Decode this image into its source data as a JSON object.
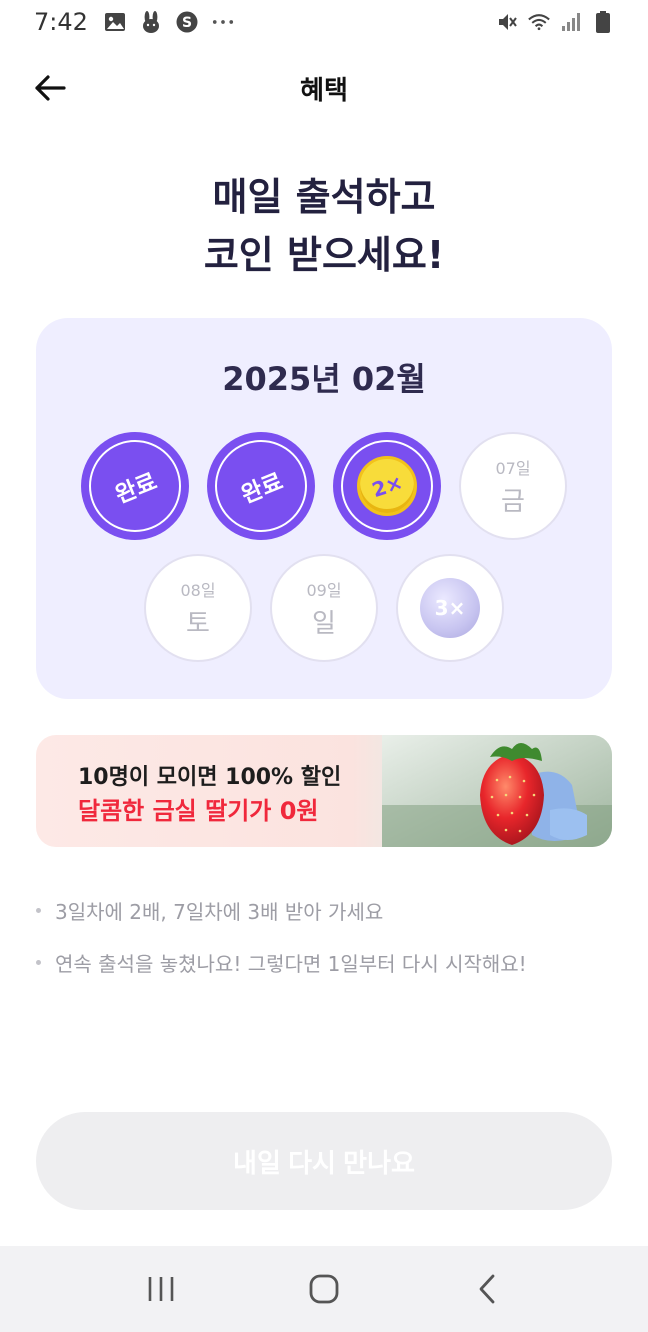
{
  "status_bar": {
    "time": "7:42",
    "icons_left": [
      "image-icon",
      "bunny-icon",
      "s-app-icon",
      "more-dots-icon"
    ],
    "icons_right": [
      "mute-icon",
      "wifi-icon",
      "signal-icon",
      "battery-icon"
    ]
  },
  "header": {
    "title": "혜택",
    "back_icon": "arrow-left-icon"
  },
  "hero": {
    "line1": "매일 출석하고",
    "line2": "코인 받으세요!"
  },
  "calendar": {
    "month": "2025년 02월",
    "days": [
      {
        "state": "done",
        "label": "완료"
      },
      {
        "state": "done",
        "label": "완료"
      },
      {
        "state": "today-bonus",
        "badge": "2×"
      },
      {
        "state": "future",
        "date": "07일",
        "weekday": "금"
      },
      {
        "state": "future",
        "date": "08일",
        "weekday": "토"
      },
      {
        "state": "future",
        "date": "09일",
        "weekday": "일"
      },
      {
        "state": "bonus",
        "badge": "3×"
      }
    ]
  },
  "banner": {
    "line1": "10명이 모이면 100% 할인",
    "line2": "달콤한 금실 딸기가 0원",
    "accent_color": "#f0283c"
  },
  "notes": [
    "3일차에 2배, 7일차에 3배 받아 가세요",
    "연속 출석을 놓쳤나요! 그렇다면 1일부터 다시 시작해요!"
  ],
  "cta": {
    "label": "내일 다시 만나요"
  },
  "colors": {
    "primary": "#7a4ff0",
    "card_bg": "#efeeff",
    "coin_gold": "#f8dc3a"
  },
  "nav": [
    "recent-apps-icon",
    "home-icon",
    "back-icon"
  ]
}
